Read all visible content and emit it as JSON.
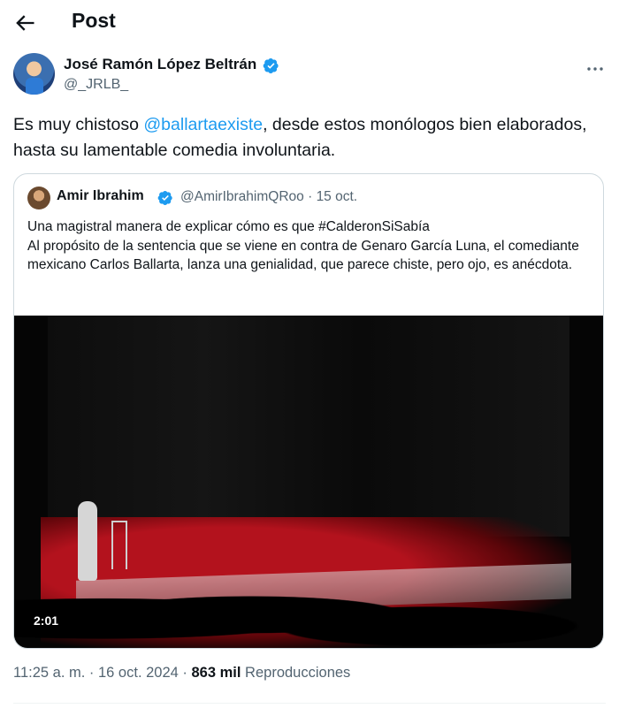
{
  "header": {
    "title": "Post"
  },
  "author": {
    "name": "José Ramón López Beltrán",
    "handle": "@_JRLB_"
  },
  "tweet": {
    "text_before": "Es muy chistoso ",
    "mention": "@ballartaexiste",
    "text_after": ", desde estos monólogos bien elaborados, hasta su lamentable comedia involuntaria."
  },
  "quote": {
    "name": "Amir Ibrahim",
    "handle": "@AmirIbrahimQRoo",
    "separator": "·",
    "date": "15 oct.",
    "line1": "Una magistral manera de explicar cómo es que #CalderonSiSabía",
    "line2": "Al propósito de la sentencia que se viene en contra de Genaro García Luna, el comediante mexicano Carlos Ballarta, lanza una genialidad, que parece chiste, pero ojo, es anécdota.",
    "video": {
      "duration": "2:01"
    }
  },
  "footer": {
    "time": "11:25 a. m.",
    "separator1": " · ",
    "date": "16 oct. 2024",
    "separator2": " · ",
    "views_count": "863 mil",
    "views_label": " Reproducciones"
  },
  "colors": {
    "accent": "#1d9bf0",
    "muted": "#536471",
    "text": "#0f1419",
    "border": "#cfd9de"
  },
  "icons": {
    "back": "arrow-left-icon",
    "verified": "verified-badge-icon",
    "more": "more-horizontal-icon"
  }
}
